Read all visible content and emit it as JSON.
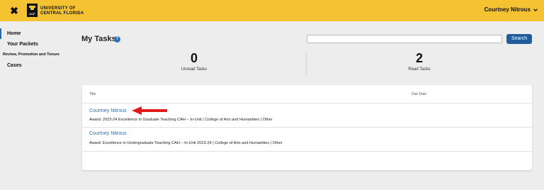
{
  "topbar": {
    "close_label": "✖",
    "logo_mark": "UCF",
    "logo_line1": "UNIVERSITY OF",
    "logo_line2": "CENTRAL FLORIDA",
    "user_name": "Courtney Nitrous",
    "accent_color": "#f5c232"
  },
  "sidebar": {
    "items": [
      {
        "label": "Home"
      },
      {
        "label": "Your Packets"
      },
      {
        "label": "Review, Promotion and Tenure"
      },
      {
        "label": "Cases"
      }
    ]
  },
  "main": {
    "title": "My Tasks",
    "help_badge": "?",
    "search_button": "Search",
    "search_value": "",
    "stats": [
      {
        "value": "0",
        "label": "Unread Tasks"
      },
      {
        "value": "2",
        "label": "Read Tasks"
      }
    ],
    "table": {
      "headers": {
        "title": "Title",
        "due_date": "Due Date"
      },
      "rows": [
        {
          "name": "Courtney Nitrous",
          "detail": "Award: 2023-24 Excellence in Graduate Teaching CAH – In-Unit | College of Arts and Humanities | Other",
          "due_date": ""
        },
        {
          "name": "Courtney Nitrous",
          "detail": "Award: Excellence in Undergraduate Teaching CAH – In-Unit 2023-24 | College of Arts and Humanities | Other",
          "due_date": ""
        }
      ]
    }
  },
  "annotation": {
    "arrow_color": "#e11b1b"
  }
}
